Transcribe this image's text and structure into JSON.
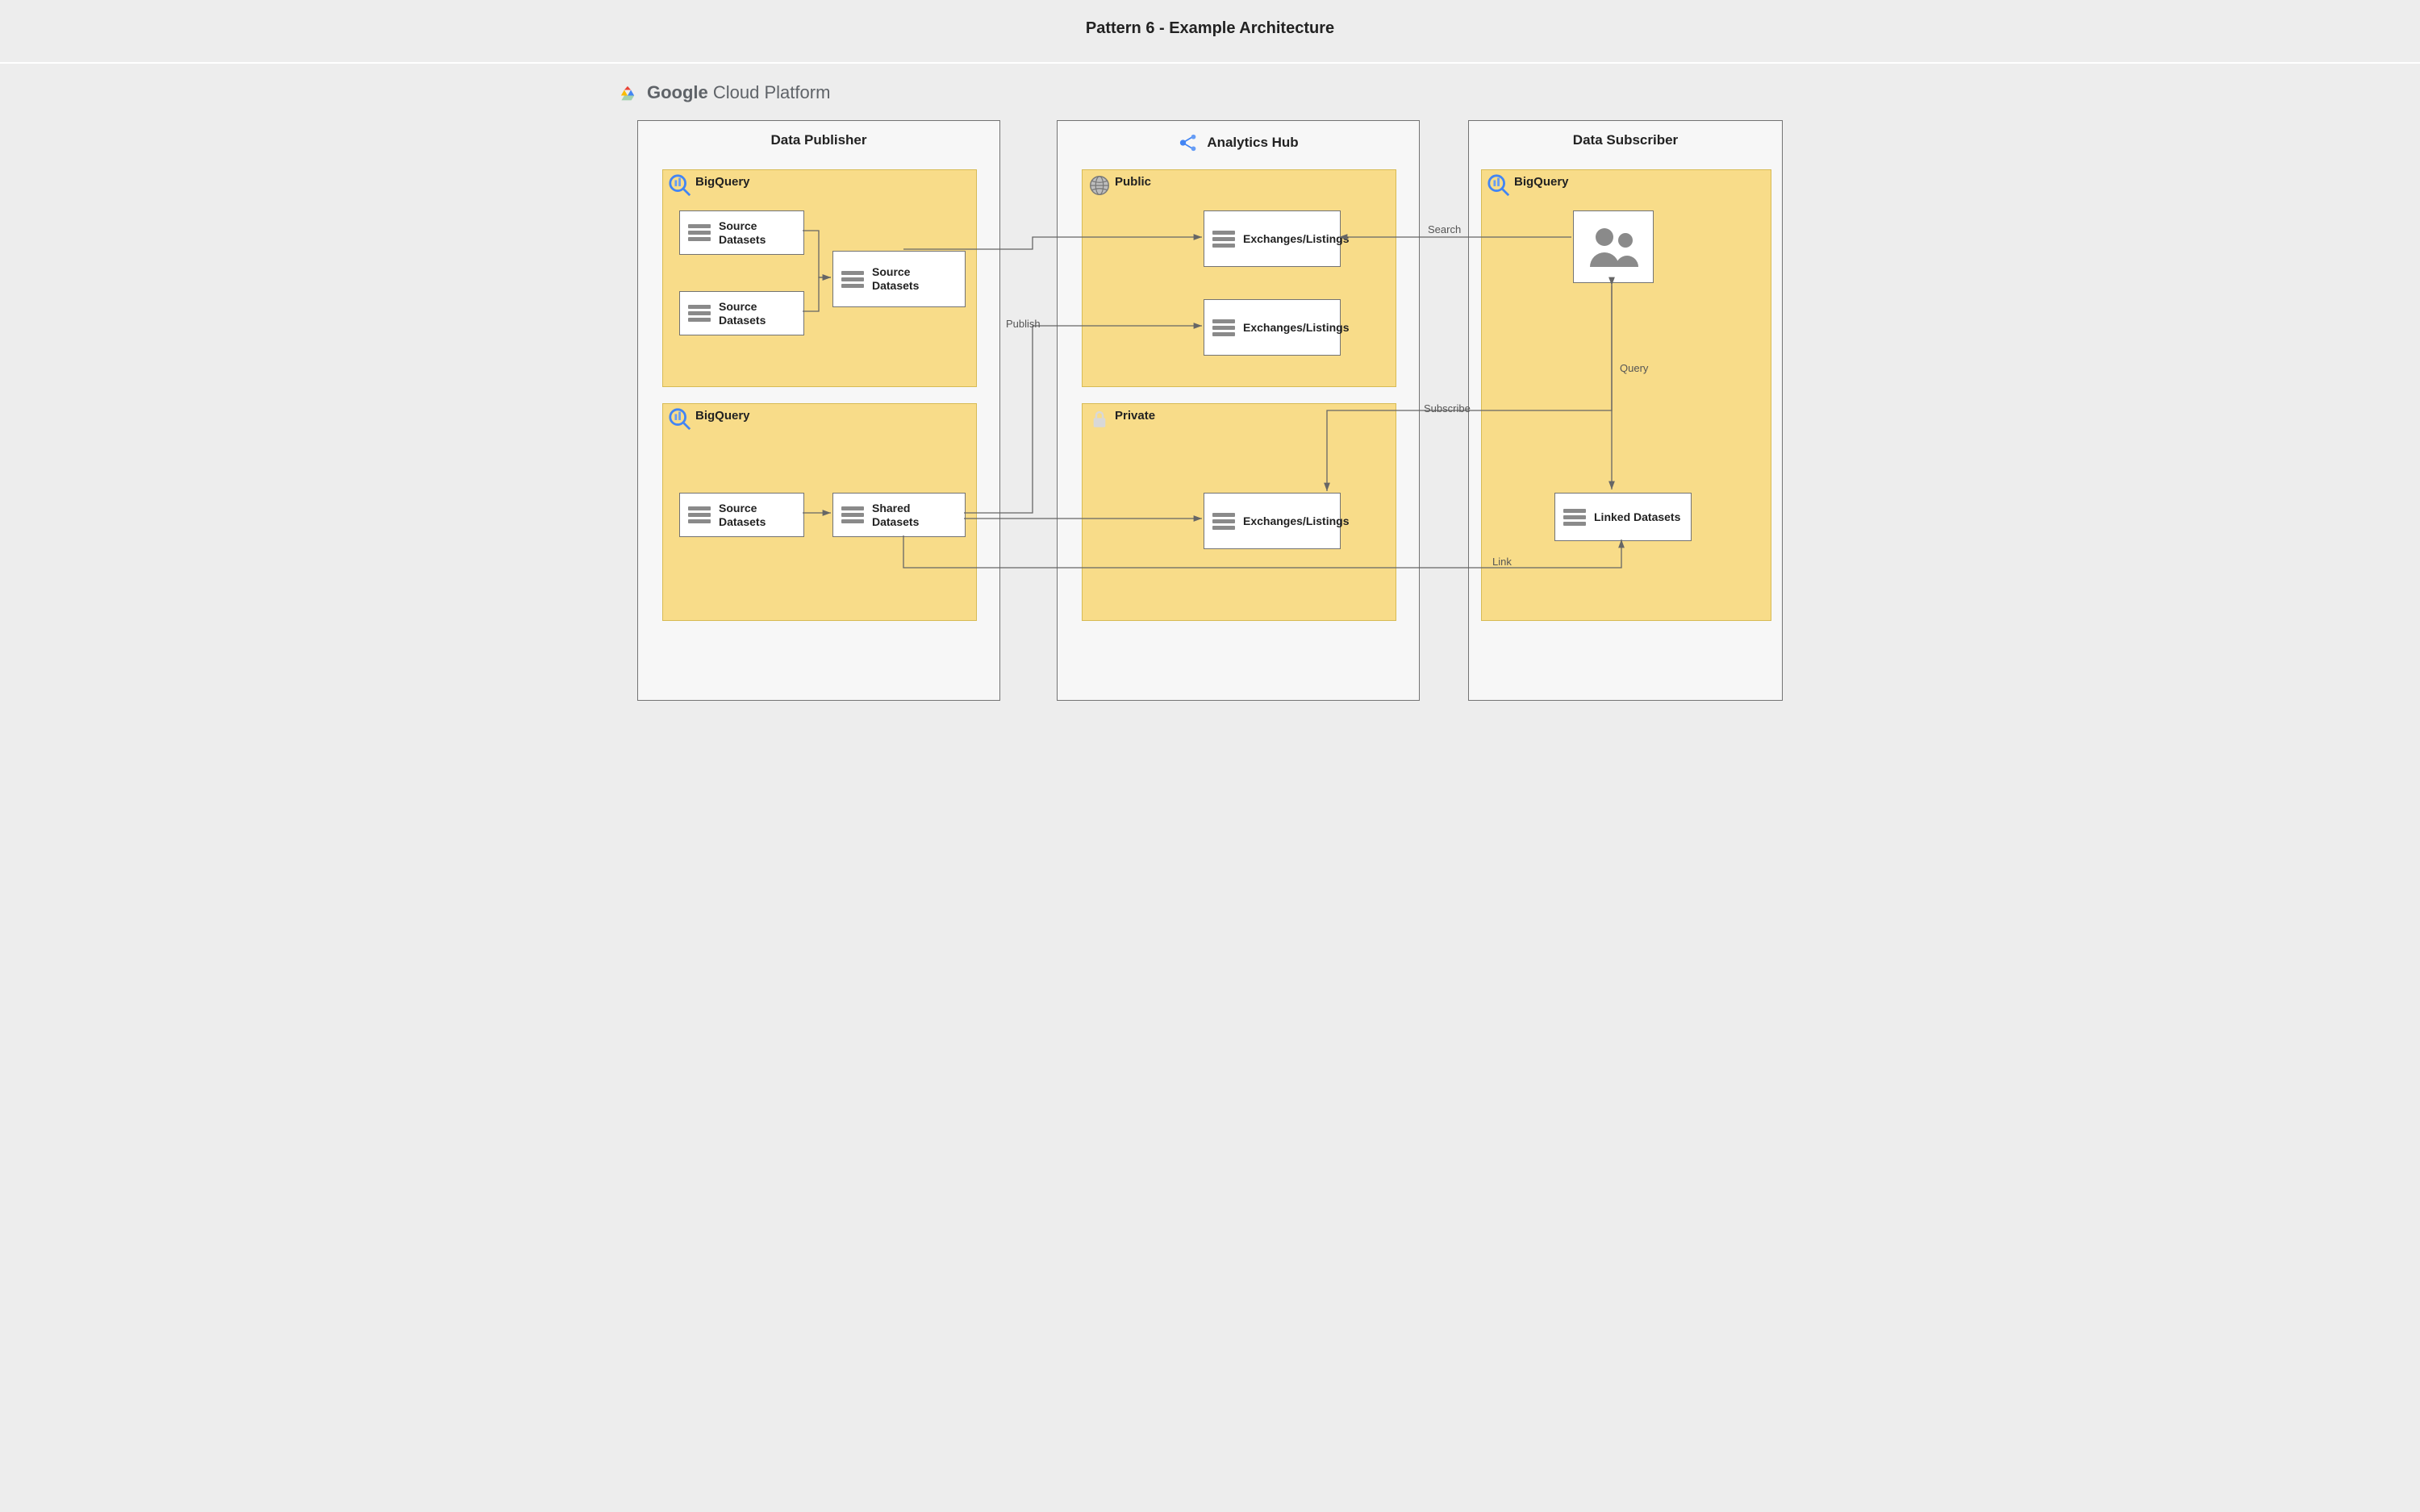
{
  "title": "Pattern 6 - Example Architecture",
  "brand": {
    "google": "Google",
    "cloud": "Cloud Platform"
  },
  "publisher": {
    "title": "Data Publisher",
    "bq_top": {
      "label": "BigQuery",
      "boxes": {
        "src1": "Source Datasets",
        "src2": "Source Datasets",
        "src3": "Source Datasets"
      }
    },
    "bq_bottom": {
      "label": "BigQuery",
      "boxes": {
        "src": "Source Datasets",
        "shared": "Shared Datasets"
      }
    }
  },
  "hub": {
    "title": "Analytics Hub",
    "public": {
      "label": "Public",
      "boxes": {
        "ex1": "Exchanges/Listings",
        "ex2": "Exchanges/Listings"
      }
    },
    "private": {
      "label": "Private",
      "boxes": {
        "ex": "Exchanges/Listings"
      }
    }
  },
  "subscriber": {
    "title": "Data Subscriber",
    "panel": {
      "label": "BigQuery",
      "boxes": {
        "linked": "Linked Datasets"
      }
    }
  },
  "edges": {
    "publish": "Publish",
    "search": "Search",
    "subscribe": "Subscribe",
    "link": "Link",
    "query": "Query"
  }
}
